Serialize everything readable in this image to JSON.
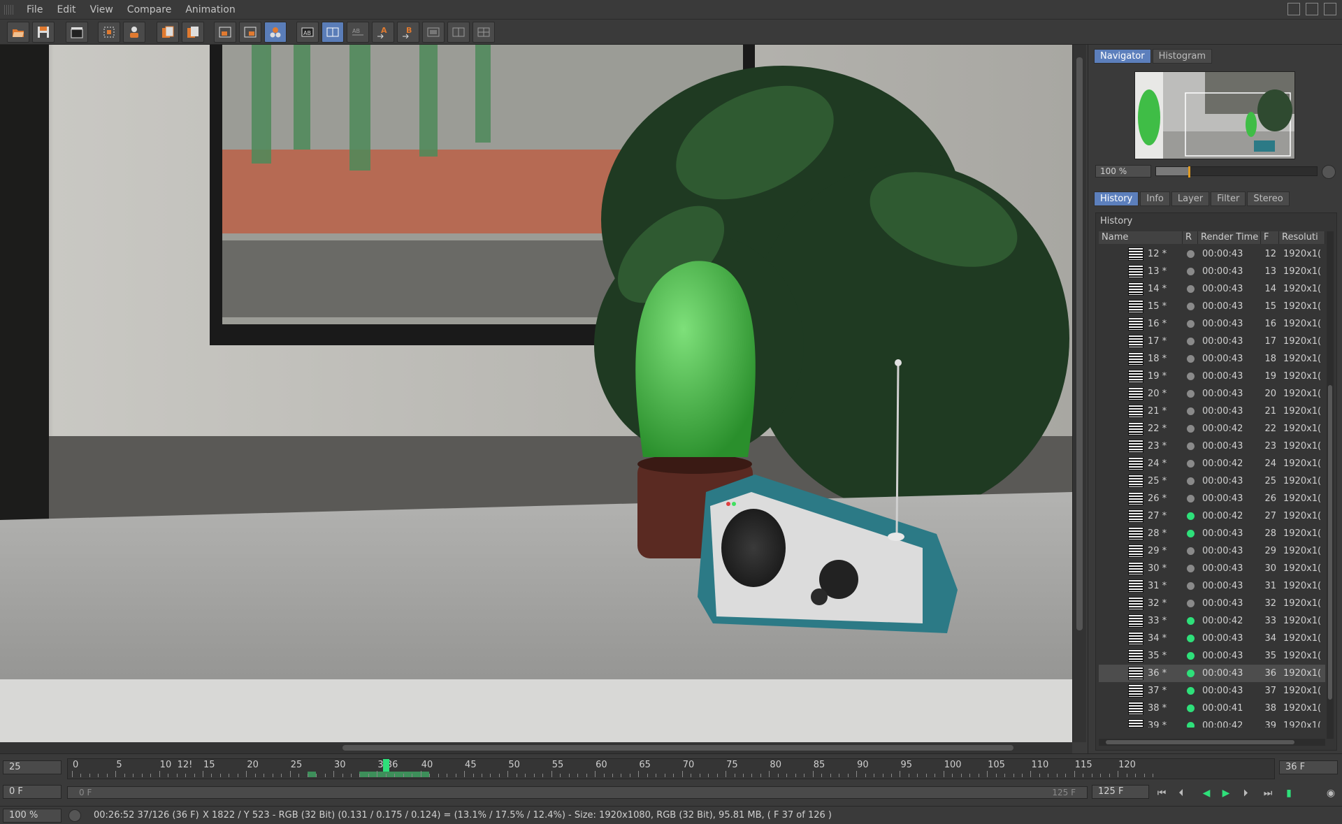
{
  "menu": [
    "File",
    "Edit",
    "View",
    "Compare",
    "Animation"
  ],
  "toolbar": {
    "buttons": [
      {
        "name": "open-icon"
      },
      {
        "name": "save-icon"
      },
      {
        "name": "clapperboard-icon"
      },
      {
        "name": "render-region-icon"
      },
      {
        "name": "person-icon"
      },
      {
        "name": "copy-image-icon"
      },
      {
        "name": "copy-alpha-icon"
      },
      {
        "name": "region-a-icon"
      },
      {
        "name": "region-b-icon"
      },
      {
        "name": "render-all-icon"
      },
      {
        "name": "ab-compare-icon"
      },
      {
        "name": "ab-split-icon"
      },
      {
        "name": "ab-diff-icon"
      },
      {
        "name": "set-a-icon"
      },
      {
        "name": "set-b-icon"
      },
      {
        "name": "layout-1-icon"
      },
      {
        "name": "layout-2-icon"
      },
      {
        "name": "layout-3-icon"
      }
    ]
  },
  "navigator": {
    "tabs": [
      "Navigator",
      "Histogram"
    ],
    "zoom": "100 %",
    "zoom_fraction": 0.2
  },
  "history": {
    "tabs": [
      "History",
      "Info",
      "Layer",
      "Filter",
      "Stereo"
    ],
    "title": "History",
    "columns": [
      "Name",
      "R",
      "Render Time",
      "F",
      "Resoluti"
    ],
    "rows": [
      {
        "name": "12 *",
        "time": "00:00:43",
        "f": "12",
        "res": "1920x1(",
        "status": "gray"
      },
      {
        "name": "13 *",
        "time": "00:00:43",
        "f": "13",
        "res": "1920x1(",
        "status": "gray"
      },
      {
        "name": "14 *",
        "time": "00:00:43",
        "f": "14",
        "res": "1920x1(",
        "status": "gray"
      },
      {
        "name": "15 *",
        "time": "00:00:43",
        "f": "15",
        "res": "1920x1(",
        "status": "gray"
      },
      {
        "name": "16 *",
        "time": "00:00:43",
        "f": "16",
        "res": "1920x1(",
        "status": "gray"
      },
      {
        "name": "17 *",
        "time": "00:00:43",
        "f": "17",
        "res": "1920x1(",
        "status": "gray"
      },
      {
        "name": "18 *",
        "time": "00:00:43",
        "f": "18",
        "res": "1920x1(",
        "status": "gray"
      },
      {
        "name": "19 *",
        "time": "00:00:43",
        "f": "19",
        "res": "1920x1(",
        "status": "gray"
      },
      {
        "name": "20 *",
        "time": "00:00:43",
        "f": "20",
        "res": "1920x1(",
        "status": "gray"
      },
      {
        "name": "21 *",
        "time": "00:00:43",
        "f": "21",
        "res": "1920x1(",
        "status": "gray"
      },
      {
        "name": "22 *",
        "time": "00:00:42",
        "f": "22",
        "res": "1920x1(",
        "status": "gray"
      },
      {
        "name": "23 *",
        "time": "00:00:43",
        "f": "23",
        "res": "1920x1(",
        "status": "gray"
      },
      {
        "name": "24 *",
        "time": "00:00:42",
        "f": "24",
        "res": "1920x1(",
        "status": "gray"
      },
      {
        "name": "25 *",
        "time": "00:00:43",
        "f": "25",
        "res": "1920x1(",
        "status": "gray"
      },
      {
        "name": "26 *",
        "time": "00:00:43",
        "f": "26",
        "res": "1920x1(",
        "status": "gray"
      },
      {
        "name": "27 *",
        "time": "00:00:42",
        "f": "27",
        "res": "1920x1(",
        "status": "green"
      },
      {
        "name": "28 *",
        "time": "00:00:43",
        "f": "28",
        "res": "1920x1(",
        "status": "green"
      },
      {
        "name": "29 *",
        "time": "00:00:43",
        "f": "29",
        "res": "1920x1(",
        "status": "gray"
      },
      {
        "name": "30 *",
        "time": "00:00:43",
        "f": "30",
        "res": "1920x1(",
        "status": "gray"
      },
      {
        "name": "31 *",
        "time": "00:00:43",
        "f": "31",
        "res": "1920x1(",
        "status": "gray"
      },
      {
        "name": "32 *",
        "time": "00:00:43",
        "f": "32",
        "res": "1920x1(",
        "status": "gray"
      },
      {
        "name": "33 *",
        "time": "00:00:42",
        "f": "33",
        "res": "1920x1(",
        "status": "green"
      },
      {
        "name": "34 *",
        "time": "00:00:43",
        "f": "34",
        "res": "1920x1(",
        "status": "green"
      },
      {
        "name": "35 *",
        "time": "00:00:43",
        "f": "35",
        "res": "1920x1(",
        "status": "green"
      },
      {
        "name": "36 *",
        "time": "00:00:43",
        "f": "36",
        "res": "1920x1(",
        "status": "green",
        "selected": true
      },
      {
        "name": "37 *",
        "time": "00:00:43",
        "f": "37",
        "res": "1920x1(",
        "status": "green"
      },
      {
        "name": "38 *",
        "time": "00:00:41",
        "f": "38",
        "res": "1920x1(",
        "status": "green"
      },
      {
        "name": "39 *",
        "time": "00:00:42",
        "f": "39",
        "res": "1920x1(",
        "status": "green"
      }
    ]
  },
  "timeline": {
    "fps": "25",
    "frame": "36 F",
    "start": "0 F",
    "range_start": "0 F",
    "range_end": "125 F",
    "end": "125 F",
    "ruler_labels": [
      "0",
      "5",
      "10",
      "15",
      "20",
      "25",
      "30",
      "35",
      "36",
      "40",
      "45",
      "50",
      "55",
      "60",
      "65",
      "70",
      "75",
      "80",
      "85",
      "90",
      "95",
      "100",
      "105",
      "110",
      "115",
      "120",
      "12!"
    ],
    "current_frame": 36,
    "max_frame": 126,
    "cached_ranges": [
      [
        27,
        28
      ],
      [
        33,
        41
      ]
    ]
  },
  "status": {
    "zoom": "100 %",
    "time": "00:26:52 37/126 (36 F)",
    "info": "X 1822 / Y 523 - RGB (32 Bit) (0.131 / 0.175 / 0.124) = (13.1% / 17.5% / 12.4%) - Size: 1920x1080, RGB (32 Bit), 95.81 MB,  ( F 37 of 126 )"
  },
  "colors": {
    "accent": "#5c7fbc",
    "status_green": "#2ee07a",
    "status_gray": "#8a8a8a"
  }
}
